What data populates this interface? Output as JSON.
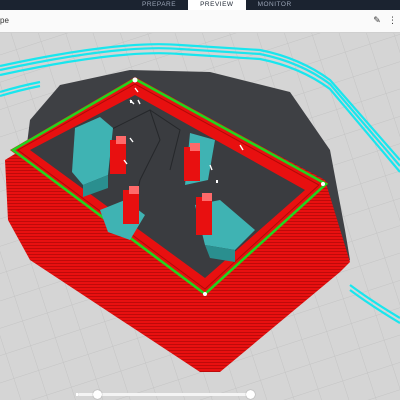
{
  "app": {
    "stage_tabs": [
      {
        "label": "PREPARE",
        "active": false
      },
      {
        "label": "PREVIEW",
        "active": true
      },
      {
        "label": "MONITOR",
        "active": false
      }
    ],
    "file_name": "pe",
    "icons": {
      "edit": "pencil-icon",
      "more": "more-vertical-icon"
    }
  },
  "colors": {
    "topbar": "#1b2330",
    "build_plate": "#d5d5d5",
    "grid_line": "#c2c2c2",
    "skirt": "#19e6ee",
    "shell_red": "#e81010",
    "inner_wall": "#22d41e",
    "support": "#3fb3b3",
    "top_surface": "#ffffff"
  },
  "preview": {
    "layer_slider_start": 0,
    "layer_slider_end": 1
  }
}
